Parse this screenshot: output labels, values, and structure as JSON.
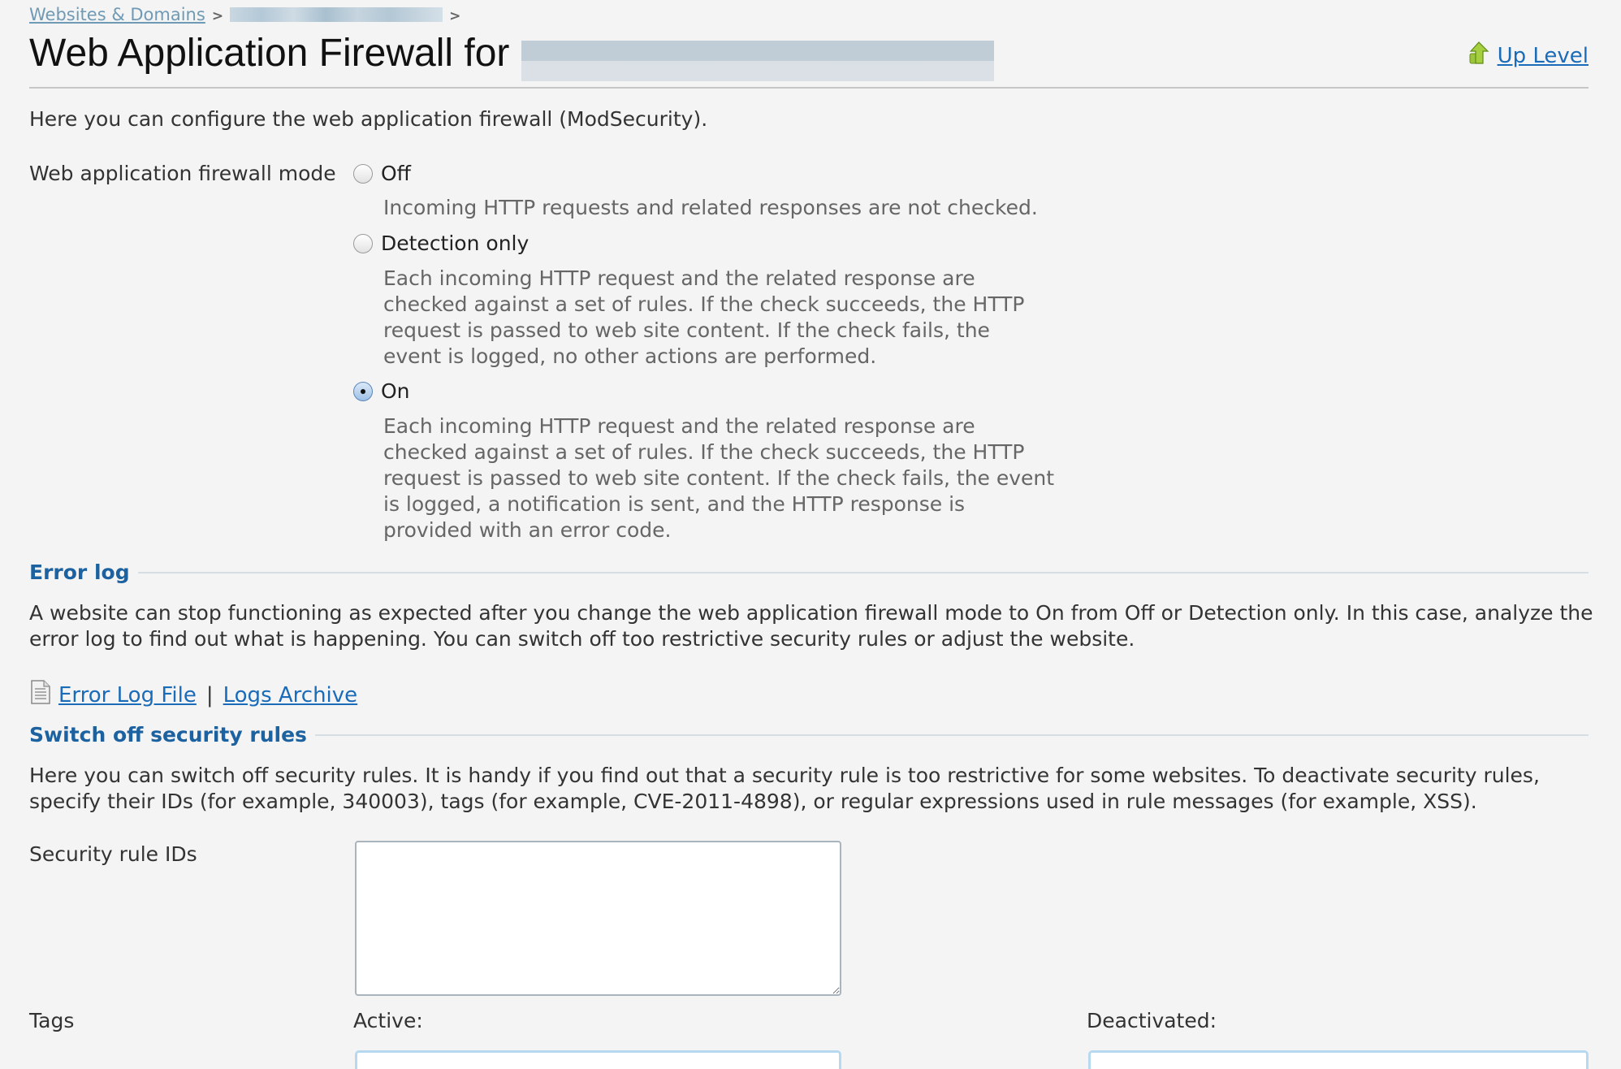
{
  "breadcrumb": {
    "items": [
      {
        "label": "Websites & Domains",
        "link": true
      },
      {
        "label": "[redacted domain]",
        "redacted": true
      }
    ],
    "separator": ">"
  },
  "header": {
    "title": "Web Application Firewall for",
    "title_suffix_redacted": true,
    "up_level_label": "Up Level",
    "up_level_icon": "up-arrow-green-icon"
  },
  "intro": "Here you can configure the web application firewall (ModSecurity).",
  "mode": {
    "label": "Web application firewall mode",
    "selected": "on",
    "options": [
      {
        "value": "off",
        "label": "Off",
        "checked": false,
        "description": "Incoming HTTP requests and related responses are not checked."
      },
      {
        "value": "detection",
        "label": "Detection only",
        "checked": false,
        "description": "Each incoming HTTP request and the related response are checked against a set of rules. If the check succeeds, the HTTP request is passed to web site content. If the check fails, the event is logged, no other actions are performed."
      },
      {
        "value": "on",
        "label": "On",
        "checked": true,
        "description": "Each incoming HTTP request and the related response are checked against a set of rules. If the check succeeds, the HTTP request is passed to web site content. If the check fails, the event is logged, a notification is sent, and the HTTP response is provided with an error code."
      }
    ]
  },
  "error_log": {
    "heading": "Error log",
    "text": "A website can stop functioning as expected after you change the web application firewall mode to On from Off or Detection only. In this case, analyze the error log to find out what is happening. You can switch off too restrictive security rules or adjust the website.",
    "file_icon": "document-icon",
    "error_log_link": "Error Log File",
    "separator": "|",
    "archive_link": "Logs Archive"
  },
  "switch_off": {
    "heading": "Switch off security rules",
    "text": "Here you can switch off security rules. It is handy if you find out that a security rule is too restrictive for some websites. To deactivate security rules, specify their IDs (for example, 340003), tags (for example, CVE-2011-4898), or regular expressions used in rule messages (for example, XSS).",
    "rule_ids_label": "Security rule IDs",
    "rule_ids_value": "",
    "tags_label": "Tags",
    "active_label": "Active:",
    "deactivated_label": "Deactivated:"
  },
  "colors": {
    "link": "#1a6bb8",
    "section_heading": "#1d62a0",
    "background": "#f4f4f4"
  }
}
